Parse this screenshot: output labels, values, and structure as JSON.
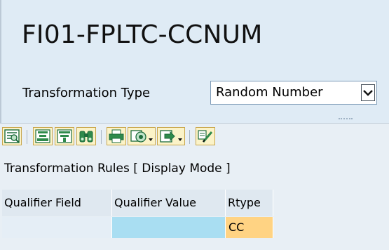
{
  "header": {
    "title": "FI01-FPLTC-CCNUM",
    "transformation_type_label": "Transformation Type",
    "transformation_type_value": "Random Number"
  },
  "toolbar": {
    "buttons": [
      {
        "icon": "details-icon"
      },
      {
        "icon": "align-icon"
      },
      {
        "icon": "filter-icon"
      },
      {
        "icon": "find-icon"
      },
      {
        "icon": "print-icon"
      },
      {
        "icon": "views-icon"
      },
      {
        "icon": "export-icon"
      },
      {
        "icon": "layout-icon"
      }
    ]
  },
  "rules": {
    "title": "Transformation Rules [ Display Mode ]",
    "columns": [
      "Qualifier Field",
      "Qualifier Value",
      "Rtype"
    ],
    "rows": [
      {
        "qualifier_field": "",
        "qualifier_value": "",
        "rtype": "CC"
      }
    ]
  },
  "colors": {
    "header_bg": "#dfebf5",
    "panel_bg": "#e8eff5",
    "qualifier_value_cell": "#a9def2",
    "rtype_cell": "#ffd383",
    "toolbar_button": "#fbf3c8"
  }
}
